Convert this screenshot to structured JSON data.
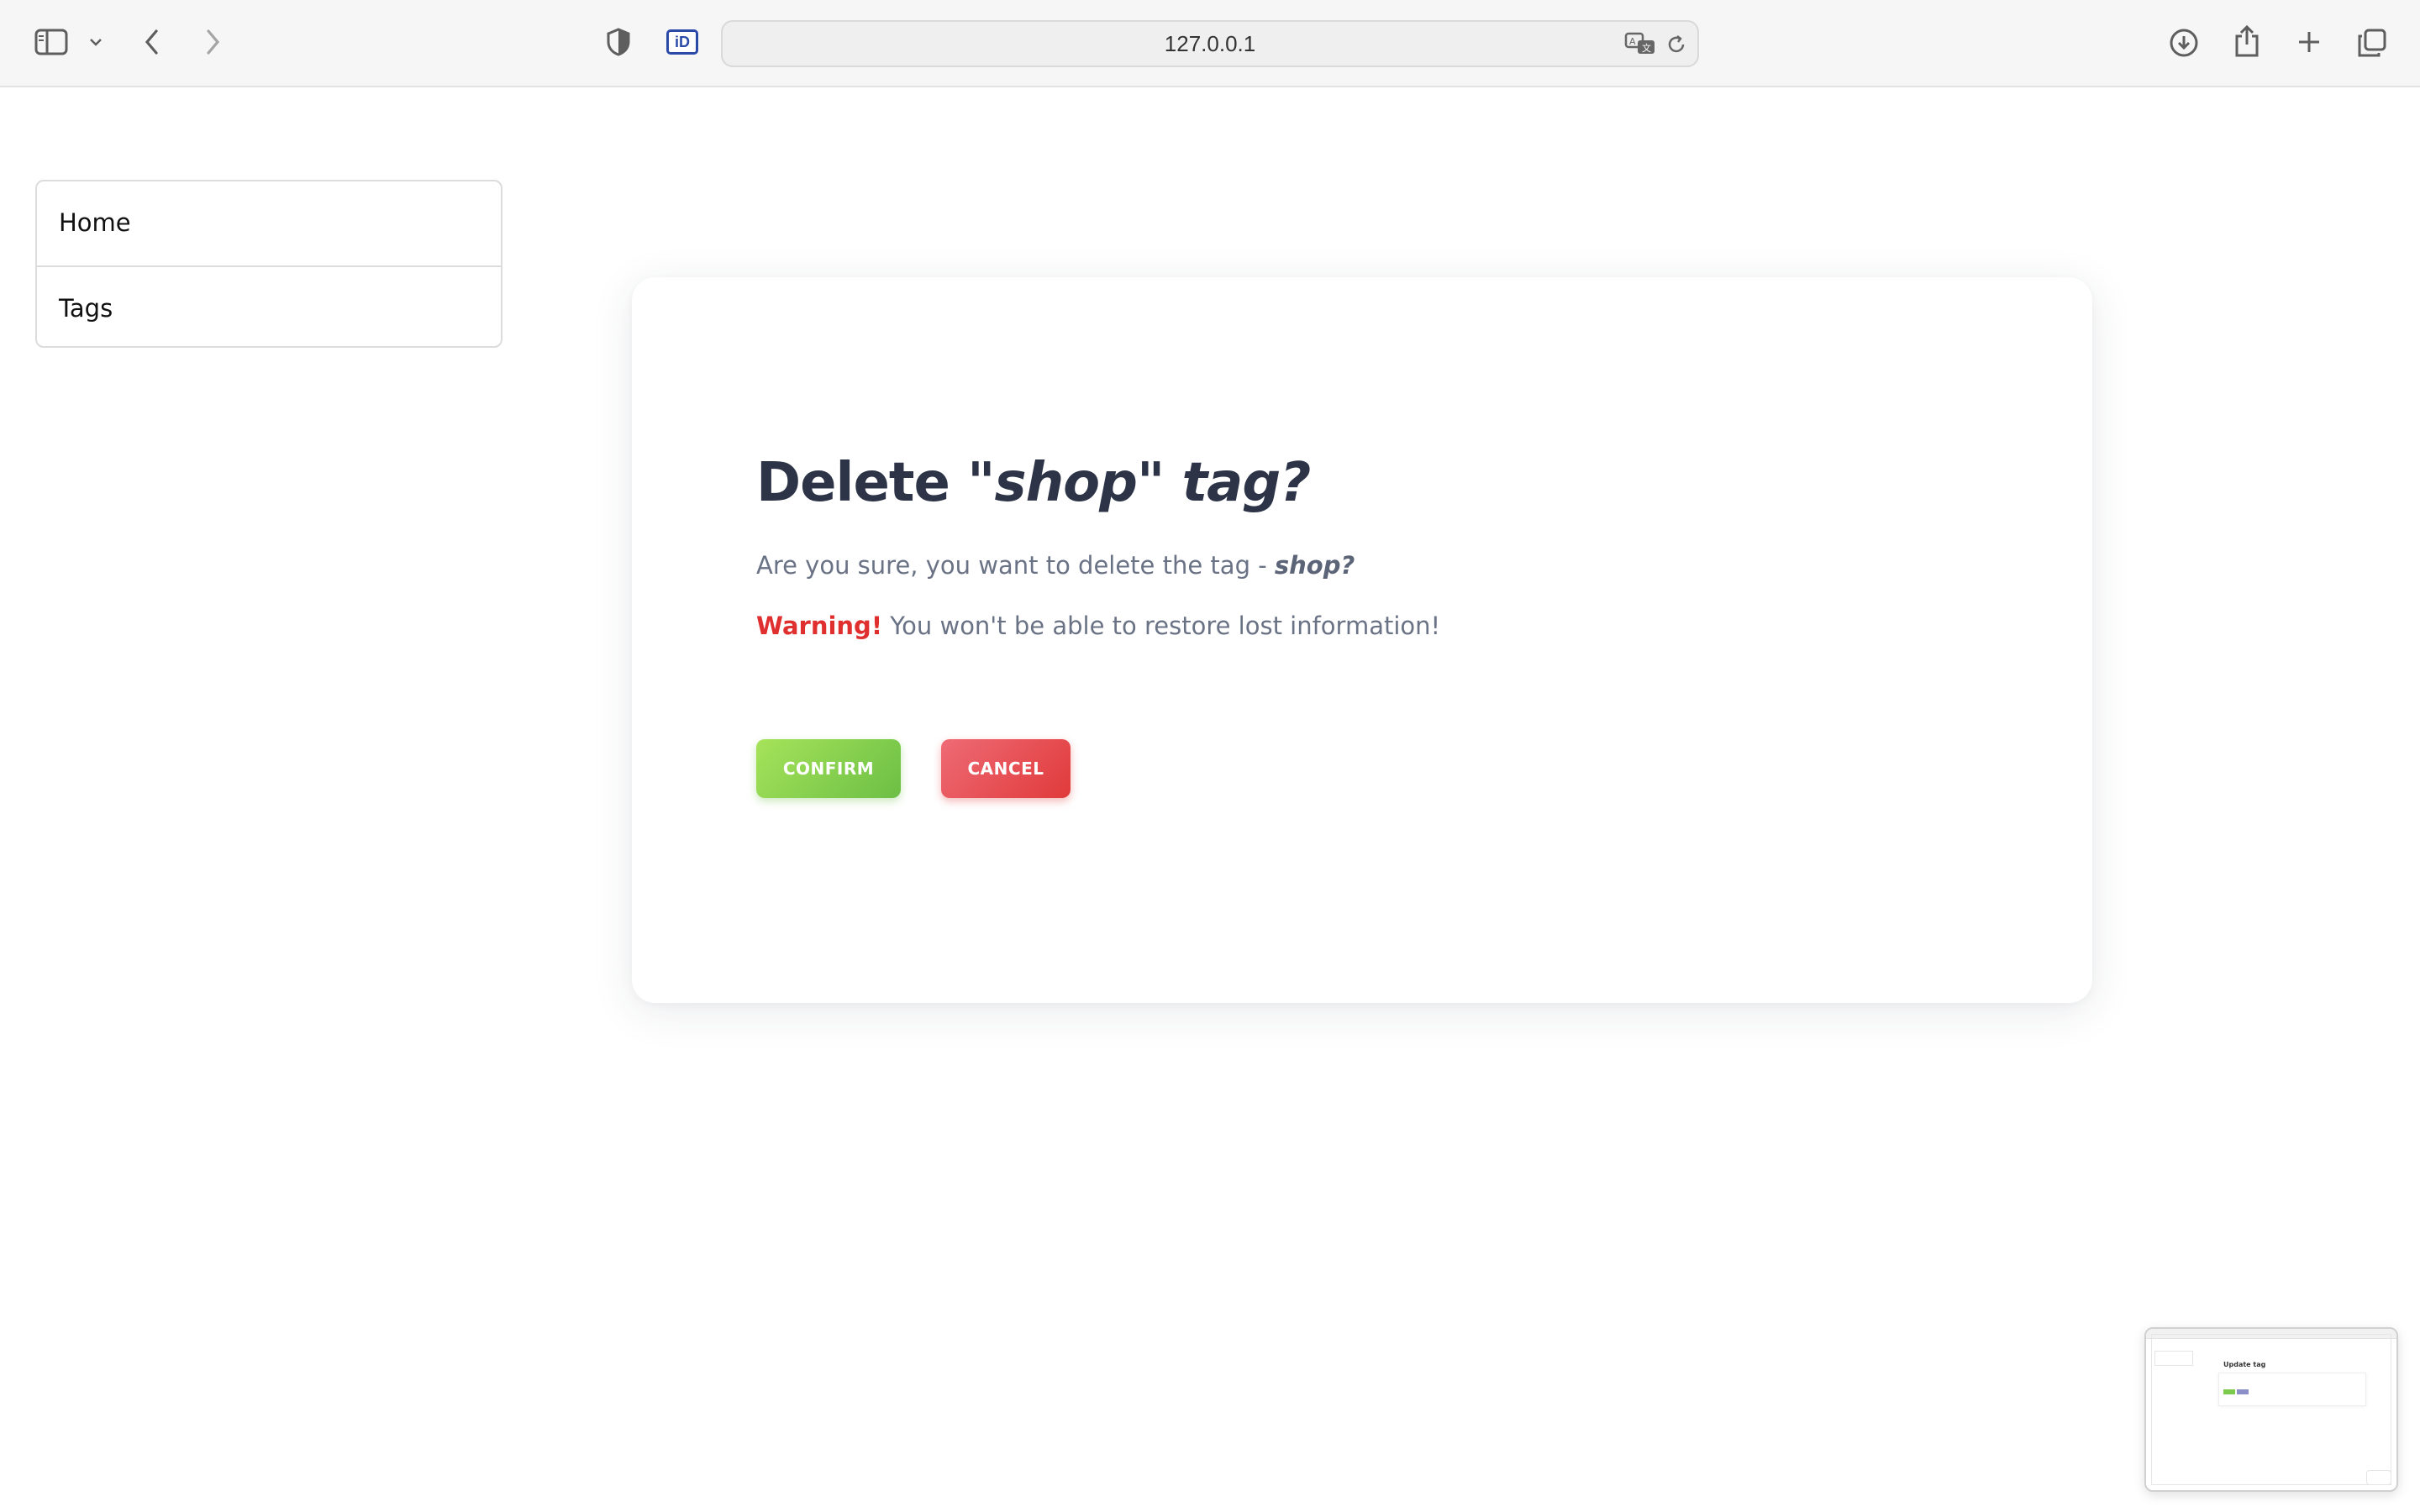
{
  "browser": {
    "url": "127.0.0.1",
    "icons": {
      "sidebar": "sidebar-icon",
      "sidebar_menu": "chevron-down-icon",
      "back": "chevron-left-icon",
      "forward": "chevron-right-icon",
      "privacy": "shield-icon",
      "extension": "id-extension-icon",
      "translate": "translate-icon",
      "reload": "reload-icon",
      "downloads": "download-icon",
      "share": "share-icon",
      "new_tab": "plus-icon",
      "tabs": "tabs-overview-icon"
    },
    "extension_label": "iD"
  },
  "nav": {
    "items": [
      {
        "label": "Home"
      },
      {
        "label": "Tags"
      }
    ]
  },
  "dialog": {
    "title_prefix": "Delete",
    "title_quoted": "\"shop\" tag?",
    "question_text": "Are you sure, you want to delete the tag -",
    "question_tag": "shop?",
    "warning_label": "Warning!",
    "warning_text": "You won't be able to restore lost information!",
    "confirm_label": "CONFIRM",
    "cancel_label": "CANCEL"
  },
  "preview": {
    "title": "Update tag"
  },
  "colors": {
    "confirm": "#6cbf45",
    "cancel": "#e03a3a",
    "warning": "#e02f2f",
    "heading": "#2d3447"
  }
}
